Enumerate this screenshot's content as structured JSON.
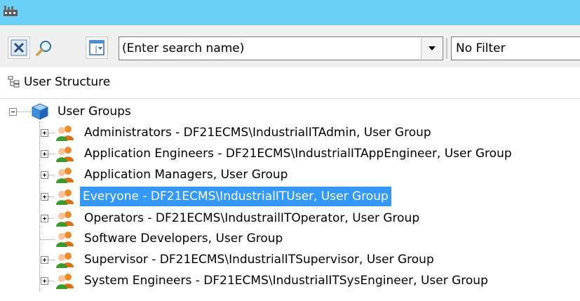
{
  "window": {
    "app_icon": "factory-icon",
    "title": ""
  },
  "toolbar": {
    "clear_icon": "clear-x-icon",
    "find_icon": "magnifier-icon",
    "view_icon": "view-list-icon",
    "search_value": "(Enter search name)",
    "filter_value": "No Filter"
  },
  "structure": {
    "label": "User Structure",
    "icon": "structure-tree-icon"
  },
  "tree": {
    "root": {
      "label": "User Groups",
      "icon": "cube-icon",
      "expanded": true
    },
    "items": [
      {
        "label": "Administrators - DF21ECMS\\IndustrialITAdmin, User Group",
        "has_children": true,
        "selected": false
      },
      {
        "label": "Application Engineers - DF21ECMS\\IndustrialITAppEngineer, User Group",
        "has_children": true,
        "selected": false
      },
      {
        "label": "Application Managers, User Group",
        "has_children": true,
        "selected": false
      },
      {
        "label": "Everyone - DF21ECMS\\IndustrialITUser, User Group",
        "has_children": true,
        "selected": true
      },
      {
        "label": "Operators - DF21ECMS\\IndustrailITOperator, User Group",
        "has_children": true,
        "selected": false
      },
      {
        "label": "Software Developers, User Group",
        "has_children": false,
        "selected": false
      },
      {
        "label": "Supervisor - DF21ECMS\\IndustrialITSupervisor, User Group",
        "has_children": true,
        "selected": false
      },
      {
        "label": "System Engineers - DF21ECMS\\IndustrialITSysEngineer, User Group",
        "has_children": true,
        "selected": false
      }
    ]
  },
  "colors": {
    "titlebar": "#6ccff6",
    "selection": "#3399ff",
    "toolbar": "#f0f0f0"
  }
}
